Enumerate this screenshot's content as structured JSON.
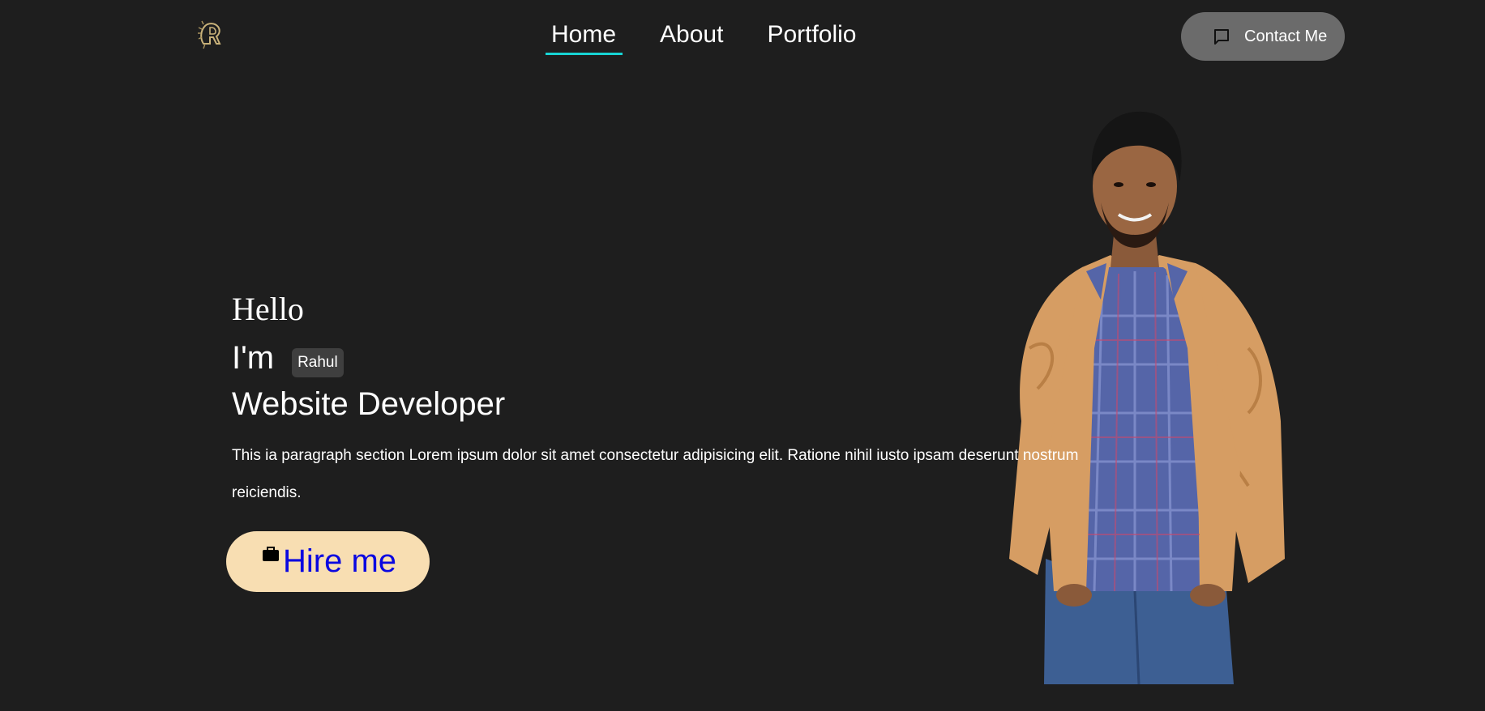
{
  "header": {
    "logo_icon": "lion-head-logo-icon",
    "nav": [
      {
        "label": "Home",
        "active": true
      },
      {
        "label": "About",
        "active": false
      },
      {
        "label": "Portfolio",
        "active": false
      }
    ],
    "contact_button": {
      "label": "Contact Me",
      "icon": "chat-bubble-icon"
    }
  },
  "hero": {
    "greeting": "Hello",
    "im": "I'm",
    "name": "Rahul",
    "role": "Website Developer",
    "paragraph": "This ia paragraph section Lorem ipsum dolor sit amet consectetur adipisicing elit. Ratione nihil iusto ipsam deserunt nostrum reiciendis.",
    "hire_button": {
      "label": "Hire me",
      "icon": "briefcase-icon"
    },
    "photo": "person-portrait-image"
  },
  "colors": {
    "background": "#1e1e1e",
    "nav_underline": "#17d4d4",
    "contact_button_bg": "#6b6b6b",
    "hire_button_bg": "#f8deb2",
    "hire_button_text": "#0b08e0",
    "name_badge_bg": "#3f3f3f"
  }
}
